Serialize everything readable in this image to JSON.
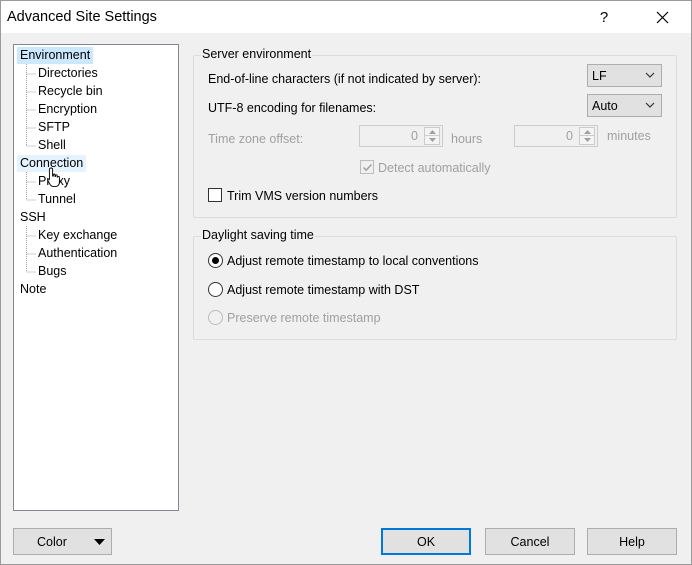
{
  "window": {
    "title": "Advanced Site Settings",
    "help_glyph": "?"
  },
  "tree": {
    "items": [
      {
        "label": "Environment",
        "level": 0,
        "state": "selected"
      },
      {
        "label": "Directories",
        "level": 1
      },
      {
        "label": "Recycle bin",
        "level": 1
      },
      {
        "label": "Encryption",
        "level": 1
      },
      {
        "label": "SFTP",
        "level": 1
      },
      {
        "label": "Shell",
        "level": 1
      },
      {
        "label": "Connection",
        "level": 0,
        "state": "hover"
      },
      {
        "label": "Proxy",
        "level": 1
      },
      {
        "label": "Tunnel",
        "level": 1
      },
      {
        "label": "SSH",
        "level": 0
      },
      {
        "label": "Key exchange",
        "level": 1
      },
      {
        "label": "Authentication",
        "level": 1
      },
      {
        "label": "Bugs",
        "level": 1
      },
      {
        "label": "Note",
        "level": 0
      }
    ]
  },
  "server_env": {
    "title": "Server environment",
    "eol_label": "End-of-line characters (if not indicated by server):",
    "eol_value": "LF",
    "utf8_label": "UTF-8 encoding for filenames:",
    "utf8_value": "Auto",
    "tz_label": "Time zone offset:",
    "tz_hours_value": "0",
    "tz_hours_unit": "hours",
    "tz_minutes_value": "0",
    "tz_minutes_unit": "minutes",
    "detect_label": "Detect automatically",
    "detect_checked": true,
    "trim_label": "Trim VMS version numbers",
    "trim_checked": false
  },
  "dst": {
    "title": "Daylight saving time",
    "options": [
      {
        "label": "Adjust remote timestamp to local conventions",
        "checked": true,
        "enabled": true
      },
      {
        "label": "Adjust remote timestamp with DST",
        "checked": false,
        "enabled": true
      },
      {
        "label": "Preserve remote timestamp",
        "checked": false,
        "enabled": false
      }
    ]
  },
  "buttons": {
    "color": "Color",
    "ok": "OK",
    "cancel": "Cancel",
    "help": "Help"
  },
  "colors": {
    "selection": "#cce8ff",
    "hover": "#e5f3ff",
    "default_button_border": "#0078d7",
    "disabled_text": "#a0a0a0"
  }
}
